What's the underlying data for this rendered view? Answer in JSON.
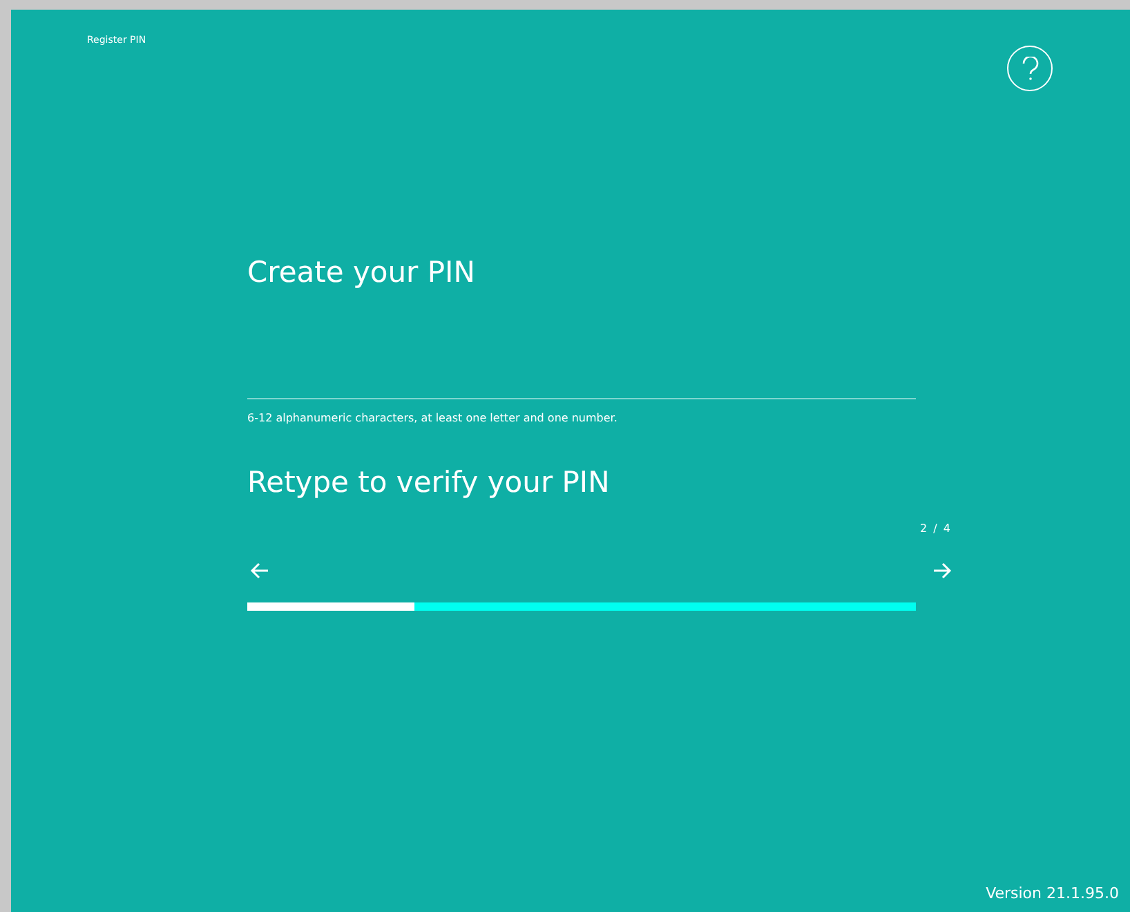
{
  "header": {
    "title": "Register PIN"
  },
  "pin": {
    "title": "Create your PIN",
    "hint": "6-12 alphanumeric characters, at least one letter and one number."
  },
  "verify": {
    "title": "Retype to verify your PIN"
  },
  "progress": {
    "counter": "2 / 4",
    "level": 0.25
  },
  "footer": {
    "version": "Version 21.1.95.0"
  }
}
